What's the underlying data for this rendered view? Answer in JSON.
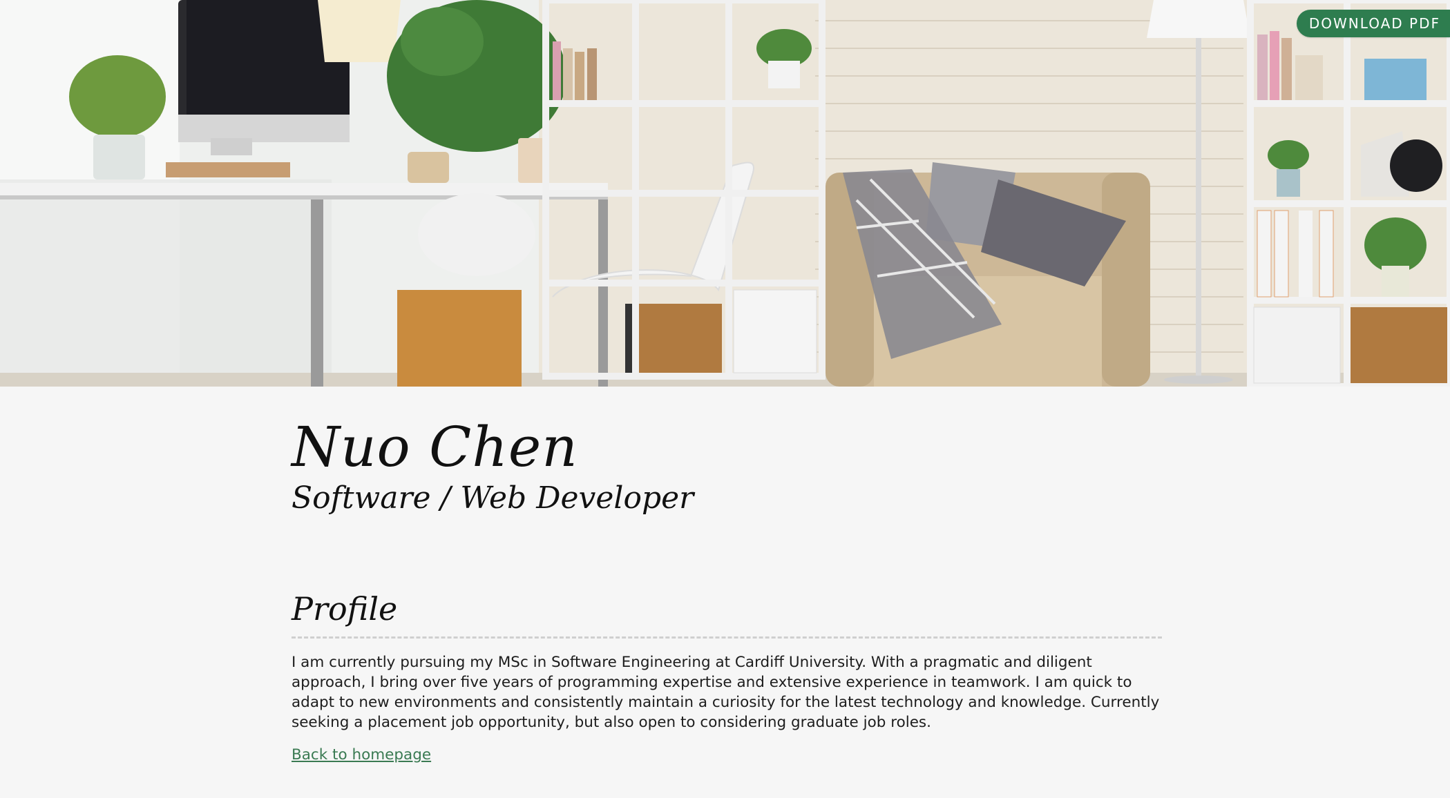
{
  "header": {
    "download_label": "DOWNLOAD PDF"
  },
  "hero": {
    "image_alt": "Home office interior with desk, chair, shelves and armchair"
  },
  "profile": {
    "name": "Nuo Chen",
    "role": "Software / Web Developer",
    "section_title": "Profile",
    "body": "I am currently pursuing my MSc in Software Engineering at Cardiff University. With a pragmatic and diligent approach, I bring over five years of programming expertise and extensive experience in teamwork. I am quick to adapt to new environments and consistently maintain a curiosity for the latest technology and knowledge. Currently seeking a placement job opportunity, but also open to considering graduate job roles.",
    "back_link": "Back to homepage"
  },
  "colors": {
    "accent": "#2e7d4f",
    "link": "#3a7a52",
    "background": "#f6f6f6"
  }
}
